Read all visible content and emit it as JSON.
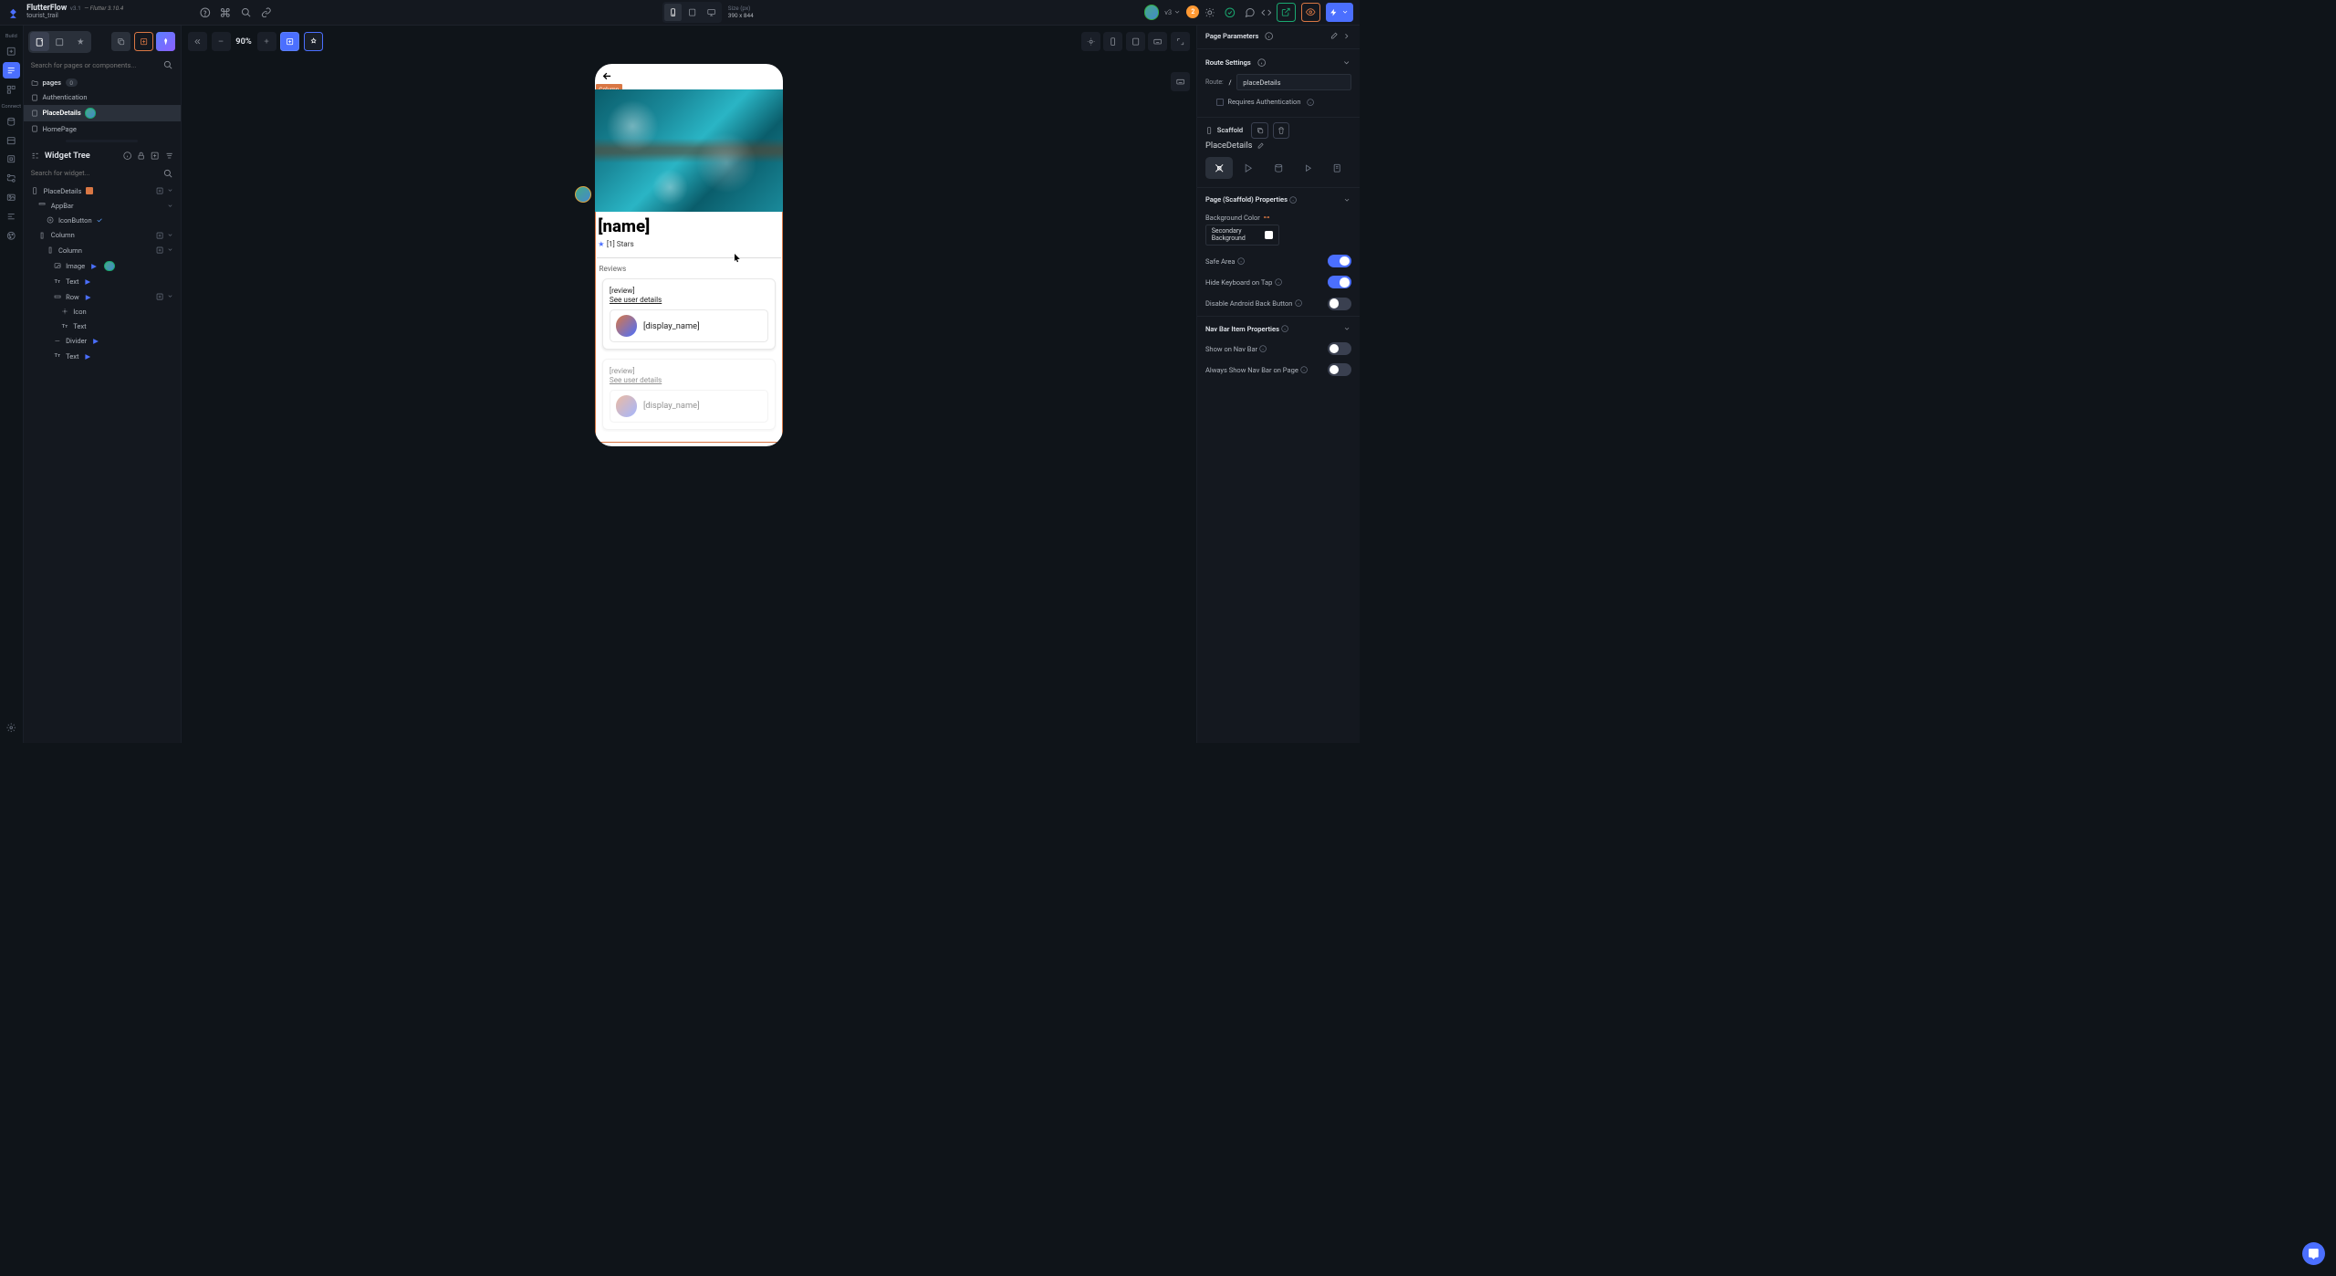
{
  "header": {
    "brand": "FlutterFlow",
    "version": "v3.1",
    "flutter": "— Flutter 3.10.4",
    "project": "tourist_trail",
    "size_label": "Size (px)",
    "size_value": "390 x 844",
    "v_label": "v3",
    "badge": "2"
  },
  "left_panel": {
    "search_pages_ph": "Search for pages or components...",
    "pages_label": "pages",
    "pages_count": "0",
    "pages": [
      {
        "label": "Authentication"
      },
      {
        "label": "PlaceDetails"
      },
      {
        "label": "HomePage"
      }
    ],
    "widget_tree_title": "Widget Tree",
    "search_widget_ph": "Search for widget...",
    "tree": {
      "root": "PlaceDetails",
      "appbar": "AppBar",
      "iconbutton": "IconButton",
      "column1": "Column",
      "column2": "Column",
      "image": "Image",
      "text1": "Text",
      "row": "Row",
      "icon": "Icon",
      "text2": "Text",
      "divider": "Divider",
      "text3": "Text"
    }
  },
  "rail": {
    "build": "Build",
    "connect": "Connect"
  },
  "canvas": {
    "zoom": "90%",
    "sel_tag": "Column",
    "preview": {
      "name": "[name]",
      "stars": "[1] Stars",
      "reviews_label": "Reviews",
      "review_text": "[review]",
      "see_details": "See user details",
      "display_name": "[display_name]"
    }
  },
  "right": {
    "page_params": "Page Parameters",
    "route_settings": "Route Settings",
    "route_label": "Route:",
    "route_slash": "/",
    "route_value": "placeDetails",
    "req_auth": "Requires Authentication",
    "scaffold": "Scaffold",
    "scaffold_name": "PlaceDetails",
    "scaffold_props": "Page (Scaffold) Properties",
    "bg_color": "Background Color",
    "bg_value": "Secondary Background",
    "safe_area": "Safe Area",
    "hide_kb": "Hide Keyboard on Tap",
    "disable_back": "Disable Android Back Button",
    "nav_props": "Nav Bar Item Properties",
    "show_nav": "Show on Nav Bar",
    "always_nav": "Always Show Nav Bar on Page"
  }
}
